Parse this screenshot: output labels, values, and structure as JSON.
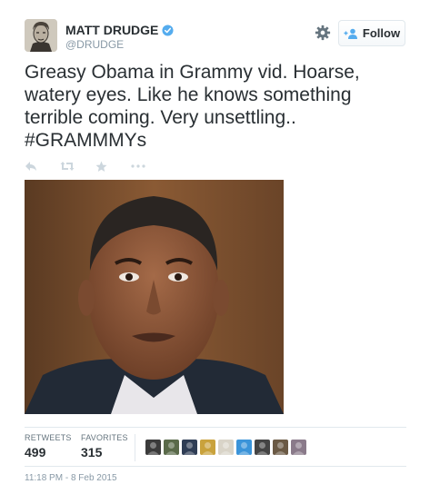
{
  "author": {
    "name": "MATT DRUDGE",
    "handle": "@DRUDGE"
  },
  "follow_label": "Follow",
  "tweet": {
    "text": "Greasy Obama in Grammy vid. Hoarse,\nwatery eyes. Like he knows something\nterrible coming. Very unsettling..\n#GRAMMMYs"
  },
  "actions": [
    {
      "icon": "reply-icon"
    },
    {
      "icon": "retweet-icon"
    },
    {
      "icon": "favorite-star-icon"
    },
    {
      "icon": "more-icon"
    }
  ],
  "stats": {
    "retweets_label": "RETWEETS",
    "retweets": "499",
    "favorites_label": "FAVORITES",
    "favorites": "315"
  },
  "favoriters": [
    {
      "color": "#3b3b3b"
    },
    {
      "color": "#5a6a4a"
    },
    {
      "color": "#2f3d55"
    },
    {
      "color": "#c9a23c"
    },
    {
      "color": "#d9d4c8"
    },
    {
      "color": "#3b94d9"
    },
    {
      "color": "#444444"
    },
    {
      "color": "#6b5a45"
    },
    {
      "color": "#8a7a8a"
    }
  ],
  "timestamp": "11:18 PM - 8 Feb 2015",
  "colors": {
    "text": "#292f33",
    "muted": "#8899a6",
    "verified": "#55acee",
    "icon": "#ccd6dd"
  }
}
